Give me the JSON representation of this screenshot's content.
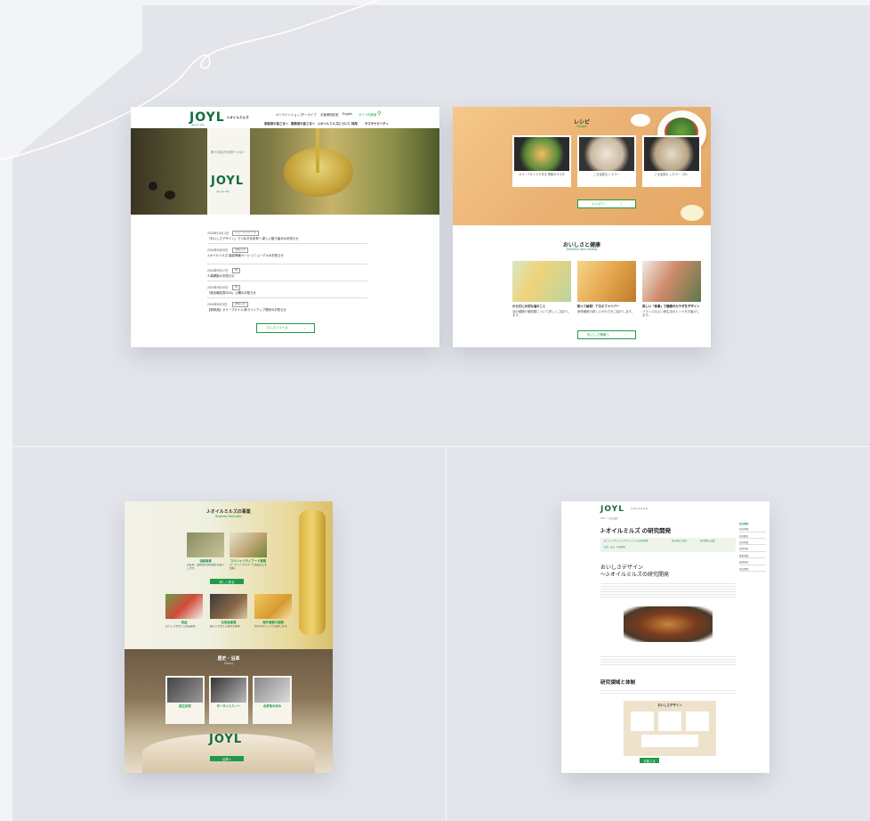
{
  "brand": {
    "logo": "JOYL",
    "tagline": "Joy for Life",
    "company": "J-オイルミルズ",
    "accent": "#1f9a48"
  },
  "card1": {
    "nav_top": [
      "オンラインショップ",
      "アーカイブ",
      "お客様相談室",
      "English",
      "サイト内検索"
    ],
    "nav_main": [
      "家庭用の皆さまへ",
      "業務用の皆さまへ",
      "J-オイルミルズについて",
      "採用",
      "サステナビリティ"
    ],
    "hero_caption": "食べる喜びを未来へつなぐ",
    "news": [
      {
        "date": "2024年10月 1日",
        "tag": "ニュースリリース",
        "text": "「おいしさデザイン」でつながる未来へ 新しい取り組みのお知らせ"
      },
      {
        "date": "2024年9月26日",
        "tag": "お知らせ",
        "text": "J-オイルミルズ 製品情報ページ リニューアルのお知らせ"
      },
      {
        "date": "2024年9月17日",
        "tag": "IR",
        "text": "人事異動のお知らせ"
      },
      {
        "date": "2024年9月10日",
        "tag": "IR",
        "text": "「統合報告書2024」公開のお知らせ"
      },
      {
        "date": "2024年9月 5日",
        "tag": "お知らせ",
        "text": "【新商品】オリーブオイル 新ラインアップ発売のお知らせ"
      }
    ],
    "press_button": "プレスリリース"
  },
  "card2": {
    "recipe_title": "レシピ",
    "recipe_sub": "Recipe",
    "recipes": [
      "オリーブオイルで作る 季節のサラダ",
      "ごま油香る レモラー",
      "ごま油香る レモラー（冷）"
    ],
    "recipe_button": "レシピへ",
    "health_title": "おいしさと健康",
    "health_sub": "Delicious and Healthy",
    "health_items": [
      {
        "title": "からだに大切な油のこと",
        "text": "油の種類や脂肪酸について詳しくご紹介します。"
      },
      {
        "title": "知って納得！アロエファイバー",
        "text": "食物繊維の新しいかたちをご紹介します。"
      },
      {
        "title": "美しい「食事」で健康のカラダをデザイン",
        "text": "バランスのよい食生活のヒントをお届けします。"
      }
    ],
    "health_button": "おいしさ情報へ"
  },
  "card3": {
    "title": "J-オイルミルズの事業",
    "sub": "Business Information",
    "biz": [
      {
        "title": "油脂事業",
        "text": "家庭用・業務用の食用油をお届けします。"
      },
      {
        "title": "スペシャリティフード事業",
        "text": "マーガリンやスターチ製品などを展開。"
      },
      {
        "title": "食品",
        "text": "おいしさを支える食品素材。"
      },
      {
        "title": "化成品事業",
        "text": "暮らしを支える素材を開発。"
      },
      {
        "title": "海外事業の展開",
        "text": "世界のおいしさに貢献します。"
      }
    ],
    "biz_button": "詳しく見る",
    "history_title": "歴史・沿革",
    "history_sub": "History",
    "history_items": [
      "創立前夜",
      "ホーネンとミノー",
      "合併後の歩み"
    ],
    "history_button": "沿革へ"
  },
  "card4": {
    "breadcrumb": "TOP ＞ 研究開発",
    "title": "J-オイルミルズ の研究開発",
    "tabs": [
      "おいしさデザインとJ-オイルミルズの研究開発",
      "研究領域と体制",
      "研究開発の成果",
      "品質・安全・技術開発"
    ],
    "h2_line1": "おいしさデザイン",
    "h2_line2": "～J-オイルミルズの研究開発",
    "section2": "研究領域と体制",
    "diagram_title": "おいしさデザイン",
    "diagram_button": "お客さま",
    "sidebar": [
      "研究開発",
      "研究領域",
      "研究拠点",
      "研究成果",
      "知的財産",
      "技術開発",
      "品質保証",
      "研究体制"
    ]
  }
}
